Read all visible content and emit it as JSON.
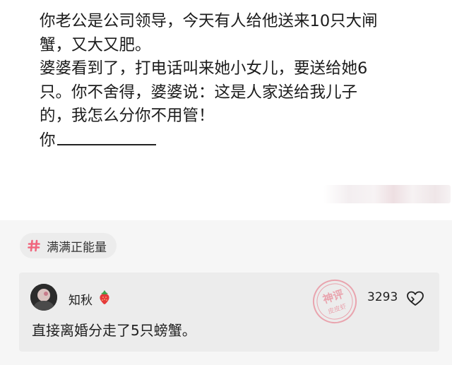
{
  "post": {
    "lines": [
      "你老公是公司领导，今天有人给他送来10只大闸",
      "蟹，又大又肥。",
      "婆婆看到了，打电话叫来她小女儿，要送给她6",
      "只。你不舍得，婆婆说：这是人家送给我儿子",
      "的，我怎么分你不用管！",
      "你"
    ]
  },
  "tag": {
    "label": "满满正能量",
    "icon": "hashtag-icon",
    "color": "#f0677e"
  },
  "comment": {
    "username": "知秋",
    "user_badge": "strawberry-icon",
    "like_count": "3293",
    "like_icon": "heart-icon",
    "text": "直接离婚分走了5只螃蟹。",
    "watermark_text": [
      "神评",
      "皮皮虾"
    ]
  }
}
